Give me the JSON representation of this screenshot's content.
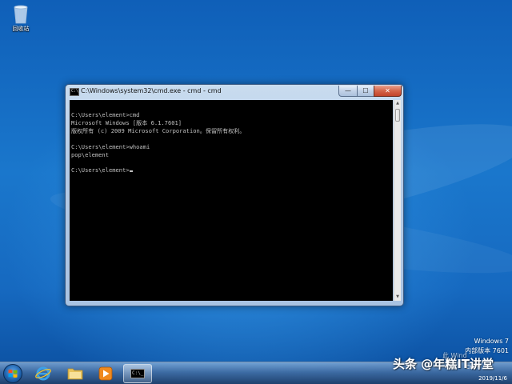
{
  "desktop": {
    "recycle_bin_label": "回收站"
  },
  "window": {
    "title": "C:\\Windows\\system32\\cmd.exe - cmd - cmd",
    "title_icon_glyph": "C:\\",
    "minimize_glyph": "—",
    "maximize_glyph": "☐",
    "close_glyph": "✕"
  },
  "console": {
    "lines": [
      "C:\\Users\\element>cmd",
      "Microsoft Windows [版本 6.1.7601]",
      "版权所有 (c) 2009 Microsoft Corporation。保留所有权利。",
      "",
      "C:\\Users\\element>whoami",
      "pop\\element",
      "",
      "C:\\Users\\element>"
    ]
  },
  "taskbar": {
    "cmd_glyph": "C:\\_"
  },
  "tray": {
    "lang": "CH",
    "date": "2019/11/6"
  },
  "overlay": {
    "os_name": "Windows 7",
    "build_text": "内部版本 7601",
    "watermark": "头条 @年糕IT讲堂",
    "watermark_small": "此 Wind"
  },
  "colors": {
    "console_bg": "#000000",
    "console_fg": "#c0c0c0",
    "desktop_blue": "#1a77cc"
  }
}
